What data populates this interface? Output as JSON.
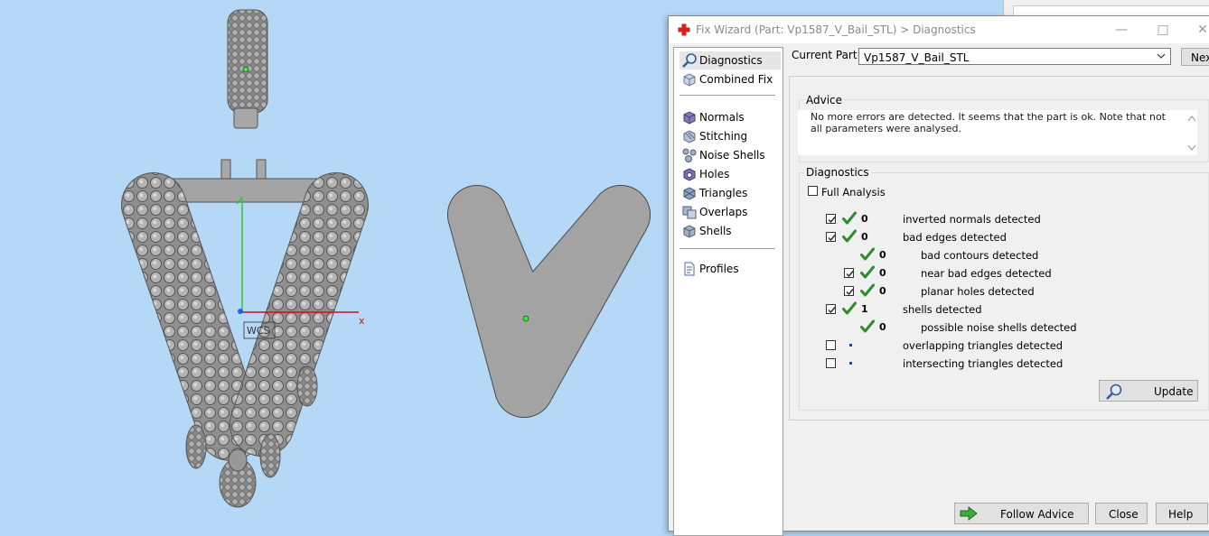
{
  "viewport": {
    "axis_x_label": "x",
    "wcs_label": "WCS"
  },
  "dialog": {
    "title": "Fix Wizard (Part: Vp1587_V_Bail_STL) > Diagnostics",
    "nav": {
      "items_top": [
        {
          "label": "Diagnostics",
          "icon": "magnifier-icon",
          "selected": true
        },
        {
          "label": "Combined Fix",
          "icon": "combined-fix-icon"
        }
      ],
      "items_mid": [
        {
          "label": "Normals",
          "icon": "normals-icon"
        },
        {
          "label": "Stitching",
          "icon": "stitching-icon"
        },
        {
          "label": "Noise Shells",
          "icon": "noise-shells-icon"
        },
        {
          "label": "Holes",
          "icon": "holes-icon"
        },
        {
          "label": "Triangles",
          "icon": "triangles-icon"
        },
        {
          "label": "Overlaps",
          "icon": "overlaps-icon"
        },
        {
          "label": "Shells",
          "icon": "shells-icon"
        }
      ],
      "items_bottom": [
        {
          "label": "Profiles",
          "icon": "document-icon"
        }
      ]
    },
    "current_part_label": "Current Part:",
    "current_part_value": "Vp1587_V_Bail_STL",
    "next_label": "Next",
    "advice": {
      "title": "Advice",
      "text": "No more errors are detected. It seems that the part is ok. Note that not all parameters were analysed."
    },
    "diagnostics": {
      "title": "Diagnostics",
      "full_analysis_label": "Full Analysis",
      "full_analysis_checked": false,
      "rows": [
        {
          "checkbox": true,
          "checked": true,
          "status": "ok",
          "value": "0",
          "label": "inverted normals detected",
          "indent": 0
        },
        {
          "checkbox": true,
          "checked": true,
          "status": "ok",
          "value": "0",
          "label": "bad edges detected",
          "indent": 0
        },
        {
          "checkbox": false,
          "checked": false,
          "status": "ok",
          "value": "0",
          "label": "bad contours detected",
          "indent": 1
        },
        {
          "checkbox": true,
          "checked": true,
          "status": "ok",
          "value": "0",
          "label": "near bad edges detected",
          "indent": 1
        },
        {
          "checkbox": true,
          "checked": true,
          "status": "ok",
          "value": "0",
          "label": "planar holes detected",
          "indent": 1
        },
        {
          "checkbox": true,
          "checked": true,
          "status": "ok",
          "value": "1",
          "label": "shells detected",
          "indent": 0
        },
        {
          "checkbox": false,
          "checked": false,
          "status": "ok",
          "value": "0",
          "label": "possible noise shells detected",
          "indent": 1
        },
        {
          "checkbox": true,
          "checked": false,
          "status": "pending",
          "value": "",
          "label": "overlapping triangles detected",
          "indent": 0
        },
        {
          "checkbox": true,
          "checked": false,
          "status": "pending",
          "value": "",
          "label": "intersecting triangles detected",
          "indent": 0
        }
      ],
      "update_label": "Update"
    },
    "buttons": {
      "follow_advice": "Follow Advice",
      "close": "Close",
      "help": "Help"
    }
  },
  "colors": {
    "viewport_bg": "#b4d8f5",
    "model_gray": "#a3a3a3",
    "check_green": "#2e8b2e",
    "axis_red": "#cc1111",
    "axis_green": "#33cc33"
  }
}
